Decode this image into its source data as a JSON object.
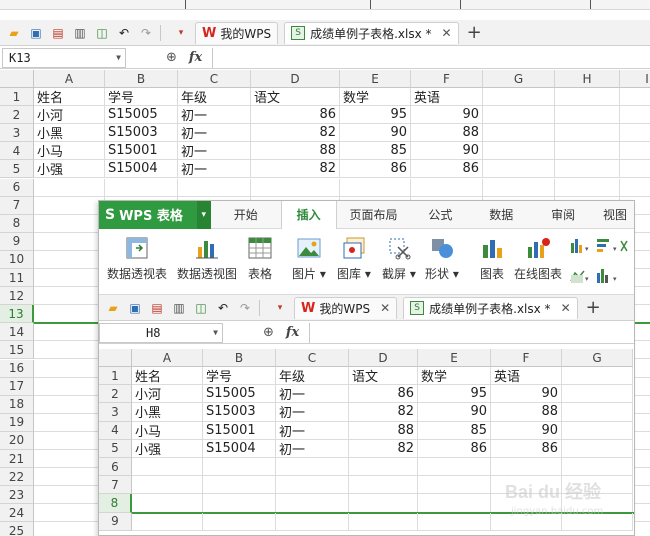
{
  "colors": {
    "accent_green": "#2f9a3f",
    "wps_red": "#d6261c"
  },
  "main": {
    "tabs": [
      {
        "label": "我的WPS",
        "icon": "wps-logo-icon"
      },
      {
        "label": "成绩单例子表格.xlsx *",
        "icon": "spreadsheet-icon"
      }
    ],
    "name_box": "K13",
    "fx_label": "fx",
    "columns": [
      "A",
      "B",
      "C",
      "D",
      "E",
      "F",
      "G",
      "H",
      "I"
    ],
    "rows": [
      "1",
      "2",
      "3",
      "4",
      "5",
      "6",
      "7",
      "8",
      "9",
      "10",
      "11",
      "12",
      "13",
      "14",
      "15",
      "16",
      "17",
      "18",
      "19",
      "20",
      "21",
      "22",
      "23",
      "24",
      "25"
    ],
    "selected_row": "13",
    "table": {
      "header": [
        "姓名",
        "学号",
        "年级",
        "语文",
        "数学",
        "英语"
      ],
      "body": [
        [
          "小河",
          "S15005",
          "初一",
          "86",
          "95",
          "90"
        ],
        [
          "小黑",
          "S15003",
          "初一",
          "82",
          "90",
          "88"
        ],
        [
          "小马",
          "S15001",
          "初一",
          "88",
          "85",
          "90"
        ],
        [
          "小强",
          "S15004",
          "初一",
          "82",
          "86",
          "86"
        ]
      ]
    }
  },
  "overlay": {
    "app_button": "WPS 表格",
    "ribbon_tabs": [
      "开始",
      "插入",
      "页面布局",
      "公式",
      "数据",
      "审阅",
      "视图"
    ],
    "active_tab": "插入",
    "ribbon_buttons": [
      {
        "label": "数据透视表",
        "icon": "pivot-table-icon"
      },
      {
        "label": "数据透视图",
        "icon": "pivot-chart-icon"
      },
      {
        "label": "表格",
        "icon": "table-icon"
      },
      {
        "label": "图片 ▾",
        "icon": "picture-icon"
      },
      {
        "label": "图库 ▾",
        "icon": "gallery-icon"
      },
      {
        "label": "截屏 ▾",
        "icon": "screenshot-icon"
      },
      {
        "label": "形状 ▾",
        "icon": "shapes-icon"
      },
      {
        "label": "图表",
        "icon": "chart-icon"
      },
      {
        "label": "在线图表",
        "icon": "online-chart-icon"
      }
    ],
    "tabs": [
      {
        "label": "我的WPS"
      },
      {
        "label": "成绩单例子表格.xlsx *"
      }
    ],
    "name_box": "H8",
    "fx_label": "fx",
    "columns": [
      "A",
      "B",
      "C",
      "D",
      "E",
      "F",
      "G"
    ],
    "rows": [
      "1",
      "2",
      "3",
      "4",
      "5",
      "6",
      "7",
      "8",
      "9"
    ],
    "selected_row": "8"
  },
  "watermark": {
    "brand": "Bai du 经验",
    "url": "jingyan.baidu.com"
  }
}
